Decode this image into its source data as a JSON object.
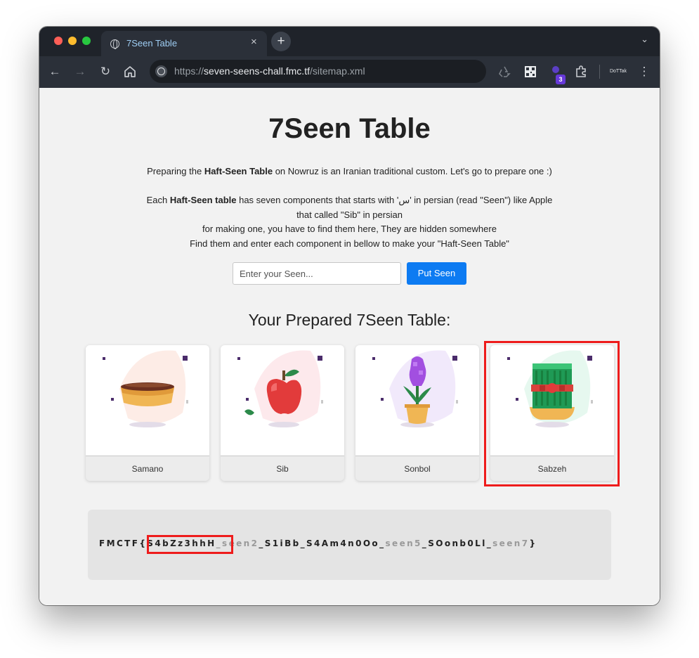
{
  "browser": {
    "tab_title": "7Seen Table",
    "tab_close": "×",
    "new_tab": "+",
    "url_scheme": "https://",
    "url_host": "seven-seens-chall.fmc.tf",
    "url_path": "/sitemap.xml",
    "extension_badge": "3",
    "profile_label": "DoTTak"
  },
  "page": {
    "title": "7Seen Table",
    "intro_before": "Preparing the ",
    "intro_bold": "Haft-Seen Table",
    "intro_after": " on Nowruz is an Iranian traditional custom. Let's go to prepare one :)",
    "desc1_before": "Each ",
    "desc1_bold": "Haft-Seen table",
    "desc1_after": " has seven components that starts with 'س' in persian (read \"Seen\") like Apple",
    "desc2": "that called \"Sib\" in persian",
    "desc3": "for making one, you have to find them here, They are hidden somewhere",
    "desc4": "Find them and enter each component in bellow to make your \"Haft-Seen Table\"",
    "input_placeholder": "Enter your Seen...",
    "button_label": "Put Seen",
    "subtitle": "Your Prepared 7Seen Table:",
    "cards": [
      {
        "label": "Samano",
        "icon": "samanu-icon"
      },
      {
        "label": "Sib",
        "icon": "apple-icon"
      },
      {
        "label": "Sonbol",
        "icon": "hyacinth-icon"
      },
      {
        "label": "Sabzeh",
        "icon": "sprouts-icon"
      }
    ],
    "flag": {
      "prefix": "FMCTF{",
      "part1": "S4bZz3hhH",
      "sep1": "_",
      "part2": "seen2",
      "sep2": "_S1iBb_S4Am4n0Oo_",
      "part3": "seen5",
      "sep3": "_SOonb0Ll_",
      "part4": "seen7",
      "suffix": "}"
    }
  },
  "colors": {
    "button": "#0d7bf2",
    "highlight": "#ee1c1c",
    "titlebar": "#1f232a",
    "tab_title": "#9ecdf3"
  }
}
